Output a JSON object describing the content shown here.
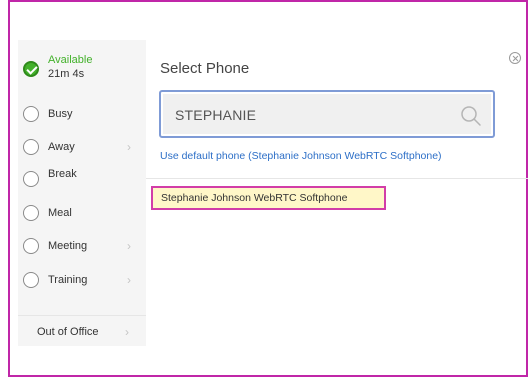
{
  "status_panel": {
    "items": [
      {
        "label": "Available",
        "time": "21m 4s",
        "active": true,
        "has_submenu": false
      },
      {
        "label": "Busy",
        "has_submenu": false
      },
      {
        "label": "Away",
        "has_submenu": true
      },
      {
        "label": "Break",
        "has_submenu": false
      },
      {
        "label": "Meal",
        "has_submenu": false
      },
      {
        "label": "Meeting",
        "has_submenu": true
      },
      {
        "label": "Training",
        "has_submenu": true
      }
    ],
    "out_of_office": "Out of Office"
  },
  "dialog": {
    "title": "Select Phone",
    "search_value": "STEPHANIE",
    "default_link": "Use default phone (Stephanie Johnson WebRTC Softphone)",
    "results": [
      "Stephanie Johnson WebRTC Softphone"
    ]
  },
  "colors": {
    "accent_border": "#c026a8",
    "available_green": "#43b12b",
    "link_blue": "#2d6fc7",
    "result_highlight": "#fff7c8",
    "search_focus": "#7f9bd6"
  },
  "icons": {
    "close": "close-circle-icon",
    "search": "search-icon",
    "submenu": "chevron-right-icon",
    "status_active": "check-circle-icon",
    "status_inactive": "radio-empty-icon"
  }
}
